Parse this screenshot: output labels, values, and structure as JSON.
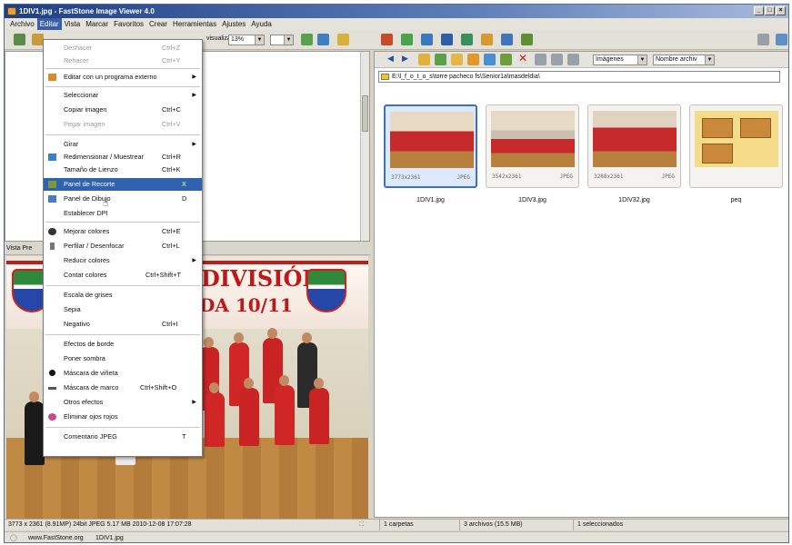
{
  "window": {
    "title": "1DIV1.jpg - FastStone Image Viewer 4.0",
    "btn_min": "_",
    "btn_max": "□",
    "btn_close": "×"
  },
  "menubar": {
    "items": [
      "Archivo",
      "Editar",
      "Vista",
      "Marcar",
      "Favoritos",
      "Crear",
      "Herramientas",
      "Ajustes",
      "Ayuda"
    ]
  },
  "toolbar": {
    "view_label": "visualizar",
    "zoom_value": "13%"
  },
  "browser": {
    "path": "E:\\l_f_o_t_o_s\\torre pacheco fs\\Senior1a\\masdeldia\\",
    "filter_value": "Imágenes",
    "sort_value": "Nombre archiv",
    "thumbnails": [
      {
        "name": "1DIV1.jpg",
        "dims": "3773x2361",
        "type": "JPEG"
      },
      {
        "name": "1DIV3.jpg",
        "dims": "3542x2361",
        "type": "JPEG"
      },
      {
        "name": "1DIV32.jpg",
        "dims": "3288x2361",
        "type": "JPEG"
      },
      {
        "name": "peq",
        "dims": "",
        "type": ""
      }
    ]
  },
  "preview": {
    "header": "Vista Pre",
    "banner_text": "DIVISIÓN",
    "banner_text2": "DA 10/11"
  },
  "editar_menu": {
    "items": [
      {
        "label": "Deshacer",
        "shortcut": "Ctrl+Z",
        "disabled": true
      },
      {
        "label": "Rehacer",
        "shortcut": "Ctrl+Y",
        "disabled": true
      },
      {
        "label": "Editar con un programa externo",
        "submenu": true
      },
      {
        "label": "Seleccionar",
        "submenu": true
      },
      {
        "label": "Copiar imagen",
        "shortcut": "Ctrl+C"
      },
      {
        "label": "Pegar imagen",
        "shortcut": "Ctrl+V",
        "disabled": true
      },
      {
        "label": "Girar",
        "submenu": true
      },
      {
        "label": "Redimensionar / Muestrear",
        "shortcut": "Ctrl+R"
      },
      {
        "label": "Tamaño de Lienzo",
        "shortcut": "Ctrl+K"
      },
      {
        "label": "Panel de Recorte",
        "shortcut": "X",
        "highlighted": true
      },
      {
        "label": "Panel de Dibujo",
        "shortcut": "D"
      },
      {
        "label": "Establecer DPI"
      },
      {
        "label": "Mejorar colores",
        "shortcut": "Ctrl+E"
      },
      {
        "label": "Perfilar / Desenfocar",
        "shortcut": "Ctrl+L"
      },
      {
        "label": "Reducir colores",
        "submenu": true
      },
      {
        "label": "Contar colores",
        "shortcut": "Ctrl+Shift+T"
      },
      {
        "label": "Escala de grises"
      },
      {
        "label": "Sepia"
      },
      {
        "label": "Negativo",
        "shortcut": "Ctrl+I"
      },
      {
        "label": "Efectos de borde"
      },
      {
        "label": "Poner sombra"
      },
      {
        "label": "Máscara de viñeta"
      },
      {
        "label": "Máscara de marco",
        "shortcut": "Ctrl+Shift+O"
      },
      {
        "label": "Otros efectos",
        "submenu": true
      },
      {
        "label": "Eliminar ojos rojos"
      },
      {
        "label": "Comentario JPEG",
        "shortcut": "T"
      }
    ]
  },
  "status": {
    "image_info": "3773 x 2361 (8.91MP)  24bit JPEG  5.17 MB  2010-12-08 17:07:28",
    "folders": "1 carpetas",
    "files": "3 archivos (15.5 MB)",
    "selected": "1 seleccionados",
    "website": "www.FastStone.org",
    "filename": "1DIV1.jpg"
  }
}
